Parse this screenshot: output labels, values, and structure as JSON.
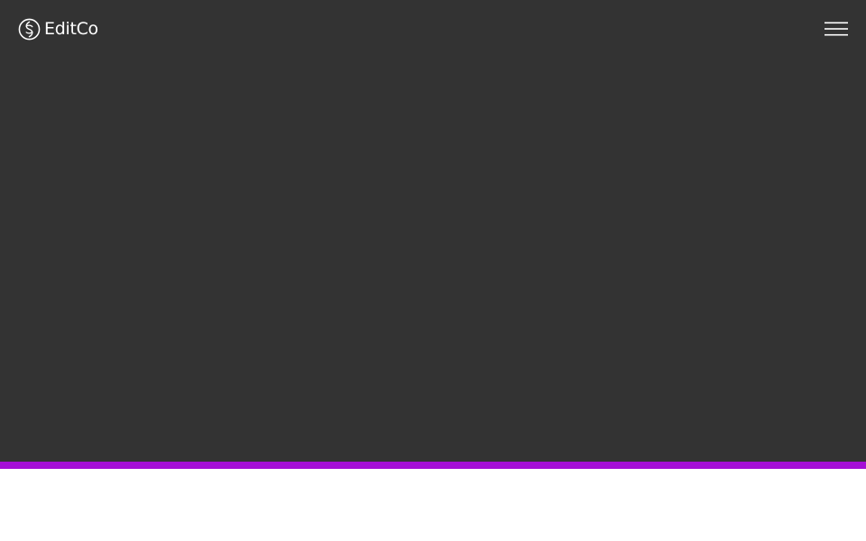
{
  "brand": {
    "name": "EditCo",
    "logo_icon": "editco-logo-icon"
  },
  "header": {
    "menu_icon": "hamburger-menu-icon"
  },
  "colors": {
    "hero_background": "#333333",
    "accent": "#a50fd6",
    "text": "#ffffff",
    "page_background": "#ffffff"
  }
}
